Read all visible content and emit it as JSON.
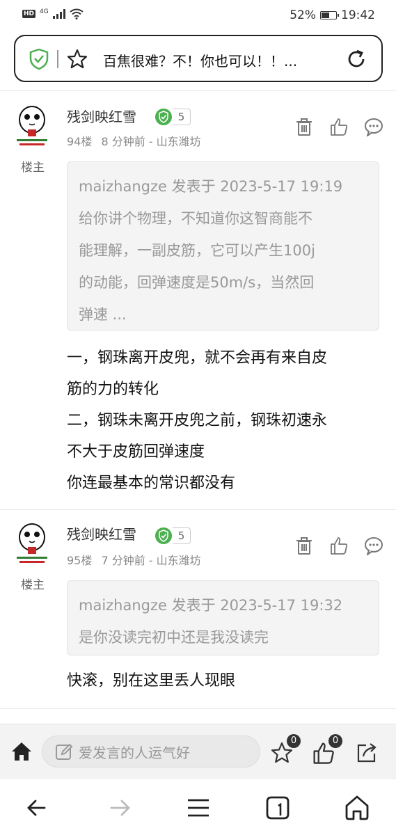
{
  "status": {
    "signal": "4G",
    "battery": "52%",
    "battery_level": 0.52,
    "time": "19:42"
  },
  "address_bar": {
    "page_title": "百焦很难？不！你也可以！！..."
  },
  "posts": [
    {
      "username": "残剑映红雪",
      "level": "5",
      "role": "楼主",
      "floor": "94楼",
      "time_ago": "8 分钟前 - 山东潍坊",
      "quote_lines": [
        "maizhangze 发表于 2023-5-17 19:19",
        "给你讲个物理，不知道你这智商能不",
        "能理解，一副皮筋，它可以产生100j",
        "的动能，回弹速度是50m/s，当然回",
        "弹速 ..."
      ],
      "body_lines": [
        "一，钢珠离开皮兜，就不会再有来自皮",
        "筋的力的转化",
        "二，钢珠未离开皮兜之前，钢珠初速永",
        "不大于皮筋回弹速度",
        "你连最基本的常识都没有"
      ]
    },
    {
      "username": "残剑映红雪",
      "level": "5",
      "role": "楼主",
      "floor": "95楼",
      "time_ago": "7 分钟前 - 山东潍坊",
      "quote_lines": [
        "maizhangze 发表于 2023-5-17 19:32",
        "是你没读完初中还是我没读完"
      ],
      "body_lines": [
        "快滚，别在这里丢人现眼"
      ]
    }
  ],
  "bottom_bar": {
    "comment_placeholder": "爱发言的人运气好",
    "favorite_count": "0",
    "like_count": "0"
  },
  "colors": {
    "accent_green": "#4caf50",
    "text_gray": "#888888"
  }
}
